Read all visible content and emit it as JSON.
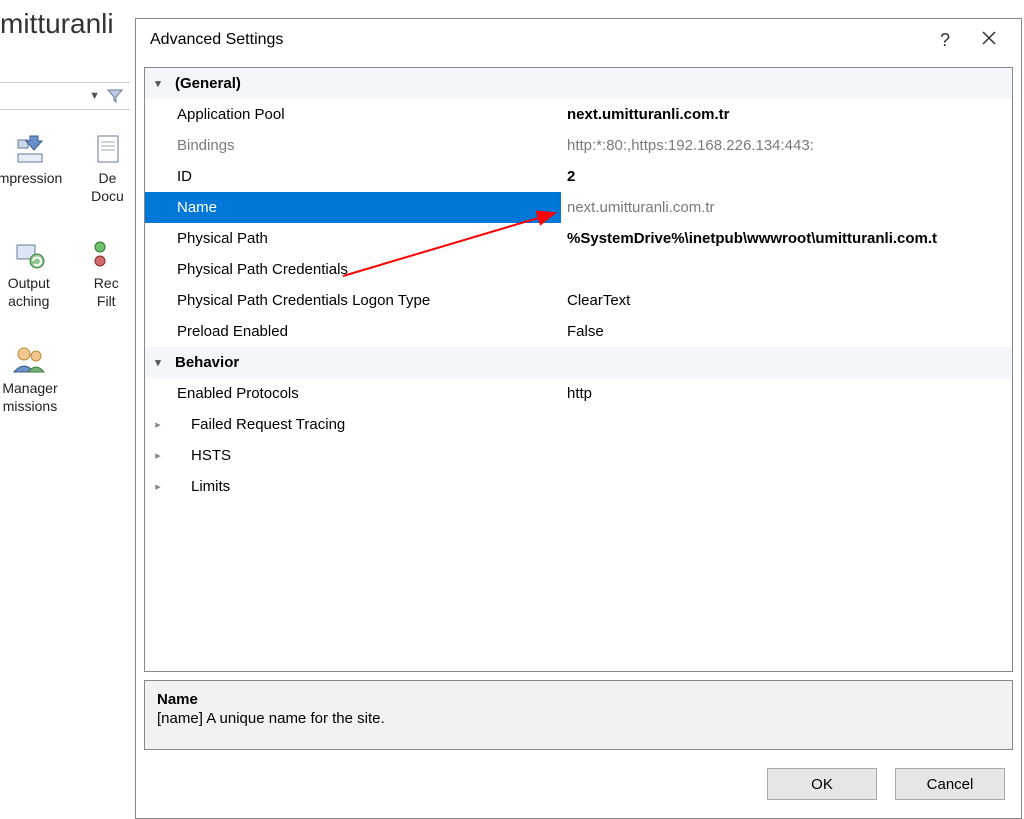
{
  "background": {
    "page_title": "mitturanli",
    "icons": {
      "compression": "mpression",
      "default_doc": "De\nDocu",
      "output_caching": "Output\naching",
      "request_filt": "Rec\nFilt",
      "manager": "Manager\nmissions"
    }
  },
  "dialog": {
    "title": "Advanced Settings",
    "groups": {
      "general": {
        "label": "(General)",
        "items": {
          "application_pool": {
            "label": "Application Pool",
            "value": "next.umitturanli.com.tr"
          },
          "bindings": {
            "label": "Bindings",
            "value": "http:*:80:,https:192.168.226.134:443:"
          },
          "id": {
            "label": "ID",
            "value": "2"
          },
          "name": {
            "label": "Name",
            "value": "next.umitturanli.com.tr"
          },
          "physical_path": {
            "label": "Physical Path",
            "value": "%SystemDrive%\\inetpub\\wwwroot\\umitturanli.com.t"
          },
          "physical_path_creds": {
            "label": "Physical Path Credentials",
            "value": ""
          },
          "physical_path_creds_logon": {
            "label": "Physical Path Credentials Logon Type",
            "value": "ClearText"
          },
          "preload": {
            "label": "Preload Enabled",
            "value": "False"
          }
        }
      },
      "behavior": {
        "label": "Behavior",
        "items": {
          "enabled_protocols": {
            "label": "Enabled Protocols",
            "value": "http"
          },
          "failed_request_tracing": {
            "label": "Failed Request Tracing"
          },
          "hsts": {
            "label": "HSTS"
          },
          "limits": {
            "label": "Limits"
          }
        }
      }
    },
    "description": {
      "name": "Name",
      "text": "[name] A unique name for the site."
    },
    "buttons": {
      "ok": "OK",
      "cancel": "Cancel"
    }
  }
}
